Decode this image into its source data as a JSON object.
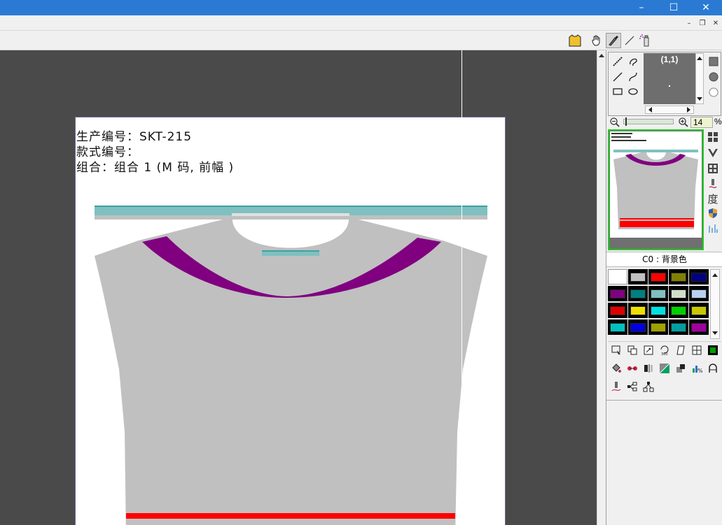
{
  "window": {
    "controls": {
      "minimize": "–",
      "maximize": "☐",
      "close": "✕"
    },
    "mdi_controls": {
      "minimize": "–",
      "restore": "❐",
      "close": "✕"
    }
  },
  "toolbar": {
    "icons": [
      "garment-shape-icon",
      "hand-pan-icon",
      "picker-tool-icon",
      "line-tool-icon",
      "spray-tool-icon"
    ]
  },
  "document": {
    "lines": [
      "生产编号：SKT-215",
      "款式编号：",
      "组合：组合 1 (M 码, 前幅 )"
    ]
  },
  "brush_panel": {
    "coord": "(1,1)"
  },
  "zoom": {
    "value": "14",
    "unit": "%"
  },
  "color_label": "C0 : 背景色",
  "palette": [
    [
      "#ffffff",
      "#c0c0c0",
      "#ff0000",
      "#808000",
      "#000080"
    ],
    [
      "#800080",
      "#008080",
      "#80c0c0",
      "#d0e0c8",
      "#b8d0f0"
    ],
    [
      "#e00000",
      "#f0e000",
      "#00e0e0",
      "#00d000",
      "#c8c800"
    ],
    [
      "#00c0c0",
      "#0000e0",
      "#a0a000",
      "#00a0a0",
      "#a000a0"
    ]
  ],
  "side_labels": {
    "degree": "度"
  },
  "colors": {
    "title_bar": "#2a7ad3",
    "canvas_bg": "#4a4a4a",
    "garment_body": "#c0c0c0",
    "collar_purple": "#800080",
    "band_teal": "#80c0c0",
    "hem_red": "#ff0000",
    "thumbnail_border": "#22cc22"
  }
}
